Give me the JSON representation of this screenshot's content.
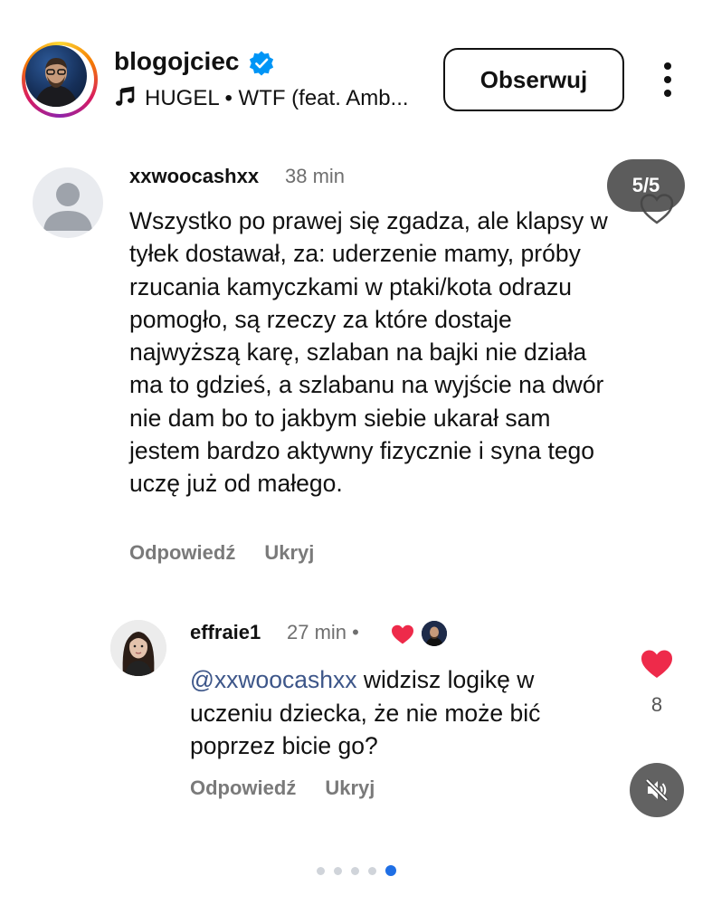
{
  "header": {
    "username": "blogojciec",
    "verified": true,
    "music_icon": "music-note-icon",
    "music_text": "HUGEL • WTF (feat. Amb...",
    "follow_label": "Obserwuj",
    "more_icon": "more-vertical-icon"
  },
  "carousel": {
    "counter": "5/5",
    "page_count": 5,
    "active_page": 5
  },
  "comments": [
    {
      "username": "xxwoocashxx",
      "time": "38 min",
      "text": "Wszystko po prawej się zgadza, ale klapsy w tyłek dostawał, za: uderzenie mamy, próby rzucania kamyczkami w ptaki/kota odrazu pomogło, są rzeczy za które dostaje najwyższą karę, szlaban na bajki nie działa ma to gdzieś, a szlabanu na wyjście na dwór nie dam bo to jakbym siebie ukarał sam jestem bardzo aktywny fizycznie i syna tego uczę już od małego.",
      "reply_label": "Odpowiedź",
      "hide_label": "Ukryj"
    },
    {
      "username": "effraie1",
      "time": "27 min",
      "separator": "•",
      "mention": "@xxwoocashxx",
      "text": "widzisz logikę w uczeniu dziecka, że nie może bić poprzez bicie go?",
      "reply_label": "Odpowiedź",
      "hide_label": "Ukryj",
      "likes": "8"
    }
  ],
  "colors": {
    "like_red": "#ee2a4a",
    "mention_blue": "#3d5689",
    "verified_blue": "#0095f6",
    "dot_active": "#1f6fe5"
  }
}
